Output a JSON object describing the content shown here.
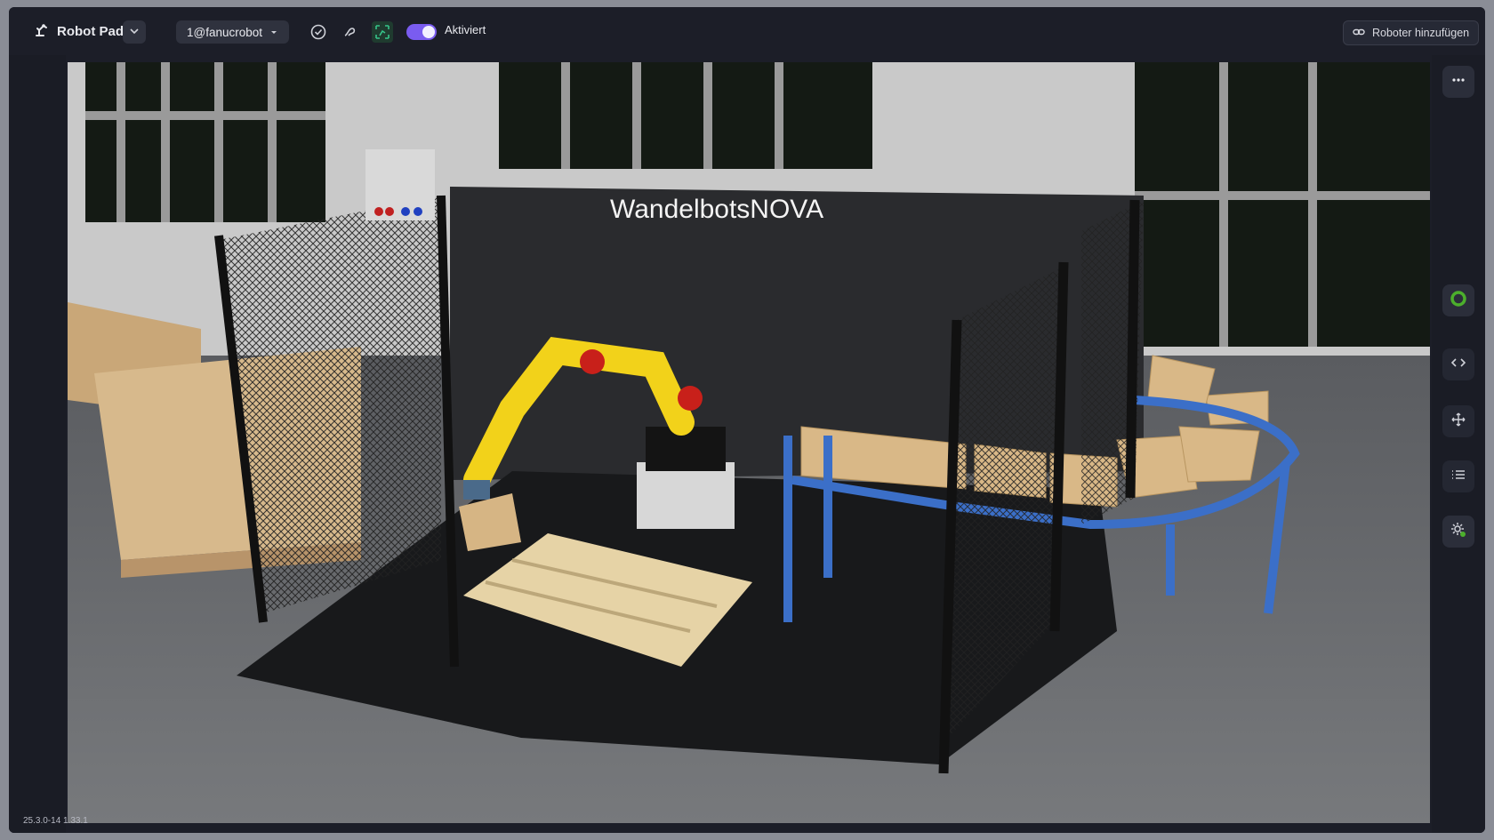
{
  "app": {
    "title": "Robot Pad",
    "logo_icon": "robot-arm-icon",
    "menu_icon": "chevron-down-icon"
  },
  "robot_selector": {
    "value": "1@fanucrobot",
    "icon": "caret-down-icon"
  },
  "toolbar": {
    "status_icons": [
      "check-circle-icon",
      "wave-icon",
      "motion-group-icon"
    ],
    "toggle": {
      "label": "Aktiviert",
      "on": true
    },
    "add_robot": {
      "label": "Roboter hinzufügen",
      "icon": "link-icon"
    }
  },
  "scene": {
    "sign_text": "WandelbotsNOVA"
  },
  "right_rail": {
    "buttons": [
      "more-icon",
      "status-ring-icon",
      "code-icon",
      "move-icon",
      "list-icon",
      "settings-icon"
    ]
  },
  "footer": {
    "version": "25.3.0-14 1.33.1"
  },
  "colors": {
    "accent": "#7a5cf0",
    "status_green": "#4caf2c",
    "background": "#1c1e28",
    "robot_yellow": "#f2d21a",
    "conveyor_blue": "#3b6fc8"
  }
}
